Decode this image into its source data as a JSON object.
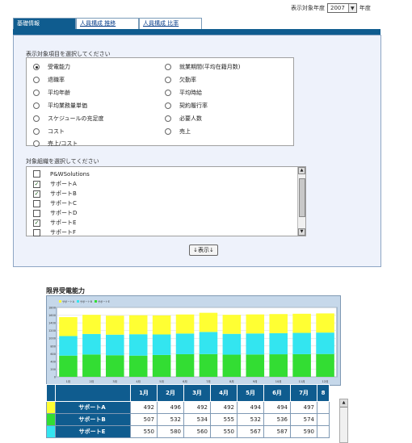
{
  "year_selector": {
    "prefix": "表示対象年度",
    "value": "2007",
    "suffix": "年度"
  },
  "tabs": [
    {
      "label": "基礎情報",
      "active": true
    },
    {
      "label": "人員構成 推移",
      "active": false
    },
    {
      "label": "人員構成 比率",
      "active": false
    }
  ],
  "metric_section": {
    "label": "表示対象項目を選択してください",
    "items": [
      {
        "label": "受電能力",
        "selected": true
      },
      {
        "label": "退職率",
        "selected": false
      },
      {
        "label": "平均年齢",
        "selected": false
      },
      {
        "label": "平均業務量単価",
        "selected": false
      },
      {
        "label": "スケジュールの充足度",
        "selected": false
      },
      {
        "label": "コスト",
        "selected": false
      },
      {
        "label": "売上/コスト",
        "selected": false
      },
      {
        "label": "就業期間(平均在籍月数)",
        "selected": false
      },
      {
        "label": "欠勤率",
        "selected": false
      },
      {
        "label": "平均時給",
        "selected": false
      },
      {
        "label": "契約履行率",
        "selected": false
      },
      {
        "label": "必要人数",
        "selected": false
      },
      {
        "label": "売上",
        "selected": false
      }
    ]
  },
  "org_section": {
    "label": "対象組織を選択してください",
    "items": [
      {
        "label": "P&WSolutions",
        "checked": false
      },
      {
        "label": "サポートA",
        "checked": true
      },
      {
        "label": "サポートB",
        "checked": true
      },
      {
        "label": "サポートC",
        "checked": false
      },
      {
        "label": "サポートD",
        "checked": false
      },
      {
        "label": "サポートE",
        "checked": true
      },
      {
        "label": "サポートF",
        "checked": false
      }
    ]
  },
  "show_button": "↓表示↓",
  "chart_title": "限界受電能力",
  "chart_data": {
    "type": "bar",
    "stacked": true,
    "categories": [
      "1月",
      "2月",
      "3月",
      "4月",
      "5月",
      "6月",
      "7月",
      "8月",
      "9月",
      "10月",
      "11月",
      "12月"
    ],
    "series": [
      {
        "name": "サポートA",
        "color": "#ffff33",
        "values": [
          492,
          496,
          492,
          492,
          494,
          494,
          497,
          493,
          494,
          495,
          496,
          497
        ]
      },
      {
        "name": "サポートB",
        "color": "#33e5f0",
        "values": [
          507,
          532,
          534,
          555,
          532,
          536,
          574,
          540,
          545,
          548,
          552,
          556
        ]
      },
      {
        "name": "サポートE",
        "color": "#33dd33",
        "values": [
          550,
          580,
          560,
          550,
          567,
          587,
          590,
          575,
          580,
          585,
          588,
          592
        ]
      }
    ],
    "ylim": [
      0,
      1800
    ],
    "yticks": [
      0,
      200,
      400,
      600,
      800,
      1000,
      1200,
      1400,
      1600,
      1800
    ],
    "legend_position": "top-left",
    "grid": true
  },
  "table": {
    "columns": [
      "1月",
      "2月",
      "3月",
      "4月",
      "5月",
      "6月",
      "7月",
      "8"
    ],
    "rows": [
      {
        "name": "サポートA",
        "color": "#ffff33",
        "values": [
          "492",
          "496",
          "492",
          "492",
          "494",
          "494",
          "497",
          ""
        ]
      },
      {
        "name": "サポートB",
        "color": "#33dd33",
        "values": [
          "507",
          "532",
          "534",
          "555",
          "532",
          "536",
          "574",
          ""
        ]
      },
      {
        "name": "サポートE",
        "color": "#33e5f0",
        "values": [
          "550",
          "580",
          "560",
          "550",
          "567",
          "587",
          "590",
          ""
        ]
      }
    ]
  }
}
